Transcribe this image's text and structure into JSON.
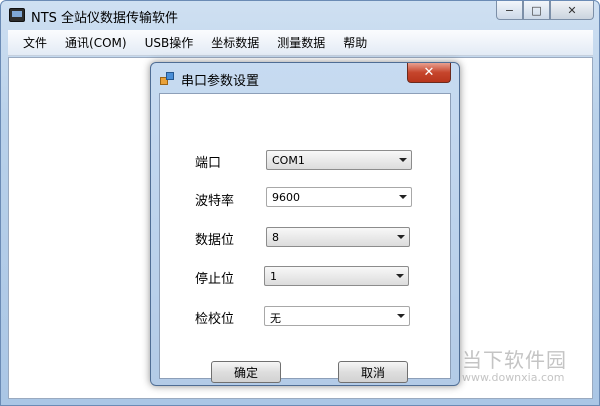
{
  "window": {
    "title": "NTS 全站仪数据传输软件",
    "minimize_glyph": "−",
    "maximize_glyph": "□",
    "close_glyph": "✕"
  },
  "menu": {
    "items": [
      {
        "label": "文件"
      },
      {
        "label": "通讯(COM)"
      },
      {
        "label": "USB操作"
      },
      {
        "label": "坐标数据"
      },
      {
        "label": "测量数据"
      },
      {
        "label": "帮助"
      }
    ]
  },
  "dialog": {
    "title": "串口参数设置",
    "close_glyph": "✕",
    "fields": {
      "port": {
        "label": "端口",
        "value": "COM1"
      },
      "baud": {
        "label": "波特率",
        "value": "9600"
      },
      "databits": {
        "label": "数据位",
        "value": "8"
      },
      "stopbits": {
        "label": "停止位",
        "value": "1"
      },
      "parity": {
        "label": "检校位",
        "value": "无"
      }
    },
    "ok_label": "确定",
    "cancel_label": "取消"
  },
  "watermark": {
    "name": "当下软件园",
    "url": "www.downxia.com"
  },
  "icons": {
    "app": "terminal-app-icon",
    "dialog": "settings-squares-icon",
    "dropdown": "chevron-down-icon"
  },
  "colors": {
    "title_bar": "#b9d1ea",
    "dialog_close": "#c6452c",
    "watermark": "#c4c4c4"
  }
}
